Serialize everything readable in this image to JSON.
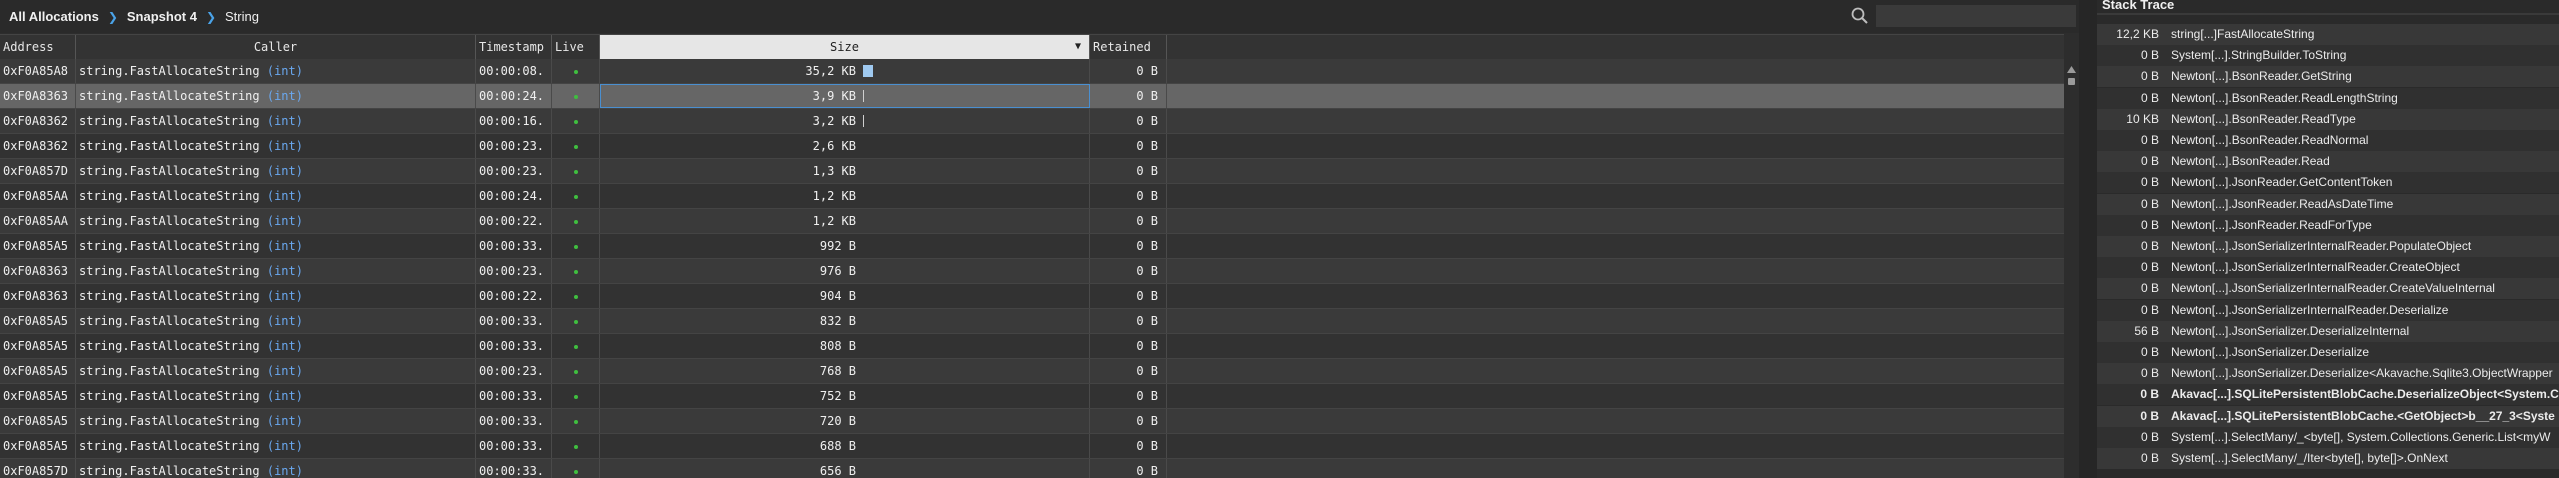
{
  "breadcrumb": {
    "items": [
      "All Allocations",
      "Snapshot 4",
      "String"
    ]
  },
  "search": {
    "value": "",
    "placeholder": ""
  },
  "grid": {
    "columns": {
      "address": "Address",
      "caller": "Caller",
      "timestamp": "Timestamp",
      "live": "Live",
      "size": "Size",
      "retained": "Retained"
    },
    "sort_indicator": "▼",
    "rows": [
      {
        "address": "0xF0A85A8",
        "caller_fn": "string.FastAllocateString",
        "caller_arg": "(int)",
        "timestamp": "00:00:08.",
        "size": "35,2 KB",
        "retained": "0 B",
        "bar": 0.95
      },
      {
        "address": "0xF0A8363",
        "caller_fn": "string.FastAllocateString",
        "caller_arg": "(int)",
        "timestamp": "00:00:24.",
        "size": "3,9 KB",
        "retained": "0 B",
        "bar": 0.1
      },
      {
        "address": "0xF0A8362",
        "caller_fn": "string.FastAllocateString",
        "caller_arg": "(int)",
        "timestamp": "00:00:16.",
        "size": "3,2 KB",
        "retained": "0 B",
        "bar": 0.08
      },
      {
        "address": "0xF0A8362",
        "caller_fn": "string.FastAllocateString",
        "caller_arg": "(int)",
        "timestamp": "00:00:23.",
        "size": "2,6 KB",
        "retained": "0 B",
        "bar": 0
      },
      {
        "address": "0xF0A857D",
        "caller_fn": "string.FastAllocateString",
        "caller_arg": "(int)",
        "timestamp": "00:00:23.",
        "size": "1,3 KB",
        "retained": "0 B",
        "bar": 0
      },
      {
        "address": "0xF0A85AA",
        "caller_fn": "string.FastAllocateString",
        "caller_arg": "(int)",
        "timestamp": "00:00:24.",
        "size": "1,2 KB",
        "retained": "0 B",
        "bar": 0
      },
      {
        "address": "0xF0A85AA",
        "caller_fn": "string.FastAllocateString",
        "caller_arg": "(int)",
        "timestamp": "00:00:22.",
        "size": "1,2 KB",
        "retained": "0 B",
        "bar": 0
      },
      {
        "address": "0xF0A85A5",
        "caller_fn": "string.FastAllocateString",
        "caller_arg": "(int)",
        "timestamp": "00:00:33.",
        "size": "992 B",
        "retained": "0 B",
        "bar": 0
      },
      {
        "address": "0xF0A8363",
        "caller_fn": "string.FastAllocateString",
        "caller_arg": "(int)",
        "timestamp": "00:00:23.",
        "size": "976 B",
        "retained": "0 B",
        "bar": 0
      },
      {
        "address": "0xF0A8363",
        "caller_fn": "string.FastAllocateString",
        "caller_arg": "(int)",
        "timestamp": "00:00:22.",
        "size": "904 B",
        "retained": "0 B",
        "bar": 0
      },
      {
        "address": "0xF0A85A5",
        "caller_fn": "string.FastAllocateString",
        "caller_arg": "(int)",
        "timestamp": "00:00:33.",
        "size": "832 B",
        "retained": "0 B",
        "bar": 0
      },
      {
        "address": "0xF0A85A5",
        "caller_fn": "string.FastAllocateString",
        "caller_arg": "(int)",
        "timestamp": "00:00:33.",
        "size": "808 B",
        "retained": "0 B",
        "bar": 0
      },
      {
        "address": "0xF0A85A5",
        "caller_fn": "string.FastAllocateString",
        "caller_arg": "(int)",
        "timestamp": "00:00:23.",
        "size": "768 B",
        "retained": "0 B",
        "bar": 0
      },
      {
        "address": "0xF0A85A5",
        "caller_fn": "string.FastAllocateString",
        "caller_arg": "(int)",
        "timestamp": "00:00:33.",
        "size": "752 B",
        "retained": "0 B",
        "bar": 0
      },
      {
        "address": "0xF0A85A5",
        "caller_fn": "string.FastAllocateString",
        "caller_arg": "(int)",
        "timestamp": "00:00:33.",
        "size": "720 B",
        "retained": "0 B",
        "bar": 0
      },
      {
        "address": "0xF0A85A5",
        "caller_fn": "string.FastAllocateString",
        "caller_arg": "(int)",
        "timestamp": "00:00:33.",
        "size": "688 B",
        "retained": "0 B",
        "bar": 0
      },
      {
        "address": "0xF0A857D",
        "caller_fn": "string.FastAllocateString",
        "caller_arg": "(int)",
        "timestamp": "00:00:33.",
        "size": "656 B",
        "retained": "0 B",
        "bar": 0
      }
    ]
  },
  "stack_trace": {
    "title": "Stack Trace",
    "frames": [
      {
        "size": "12,2 KB",
        "name": "string[...]FastAllocateString",
        "bold": false
      },
      {
        "size": "0 B",
        "name": "System[...].StringBuilder.ToString",
        "bold": false
      },
      {
        "size": "0 B",
        "name": "Newton[...].BsonReader.GetString",
        "bold": false
      },
      {
        "size": "0 B",
        "name": "Newton[...].BsonReader.ReadLengthString",
        "bold": false
      },
      {
        "size": "10 KB",
        "name": "Newton[...].BsonReader.ReadType",
        "bold": false
      },
      {
        "size": "0 B",
        "name": "Newton[...].BsonReader.ReadNormal",
        "bold": false
      },
      {
        "size": "0 B",
        "name": "Newton[...].BsonReader.Read",
        "bold": false
      },
      {
        "size": "0 B",
        "name": "Newton[...].JsonReader.GetContentToken",
        "bold": false
      },
      {
        "size": "0 B",
        "name": "Newton[...].JsonReader.ReadAsDateTime",
        "bold": false
      },
      {
        "size": "0 B",
        "name": "Newton[...].JsonReader.ReadForType",
        "bold": false
      },
      {
        "size": "0 B",
        "name": "Newton[...].JsonSerializerInternalReader.PopulateObject",
        "bold": false
      },
      {
        "size": "0 B",
        "name": "Newton[...].JsonSerializerInternalReader.CreateObject",
        "bold": false
      },
      {
        "size": "0 B",
        "name": "Newton[...].JsonSerializerInternalReader.CreateValueInternal",
        "bold": false
      },
      {
        "size": "0 B",
        "name": "Newton[...].JsonSerializerInternalReader.Deserialize",
        "bold": false
      },
      {
        "size": "56 B",
        "name": "Newton[...].JsonSerializer.DeserializeInternal",
        "bold": false
      },
      {
        "size": "0 B",
        "name": "Newton[...].JsonSerializer.Deserialize",
        "bold": false
      },
      {
        "size": "0 B",
        "name": "Newton[...].JsonSerializer.Deserialize<Akavache.Sqlite3.ObjectWrapper",
        "bold": false
      },
      {
        "size": "0 B",
        "name": "Akavac[...].SQLitePersistentBlobCache.DeserializeObject<System.C",
        "bold": true
      },
      {
        "size": "0 B",
        "name": "Akavac[...].SQLitePersistentBlobCache.<GetObject>b__27_3<Syste",
        "bold": true
      },
      {
        "size": "0 B",
        "name": "System[...].SelectMany/_<byte[], System.Collections.Generic.List<myW",
        "bold": false
      },
      {
        "size": "0 B",
        "name": "System[...].SelectMany/_/Iter<byte[], byte[]>.OnNext",
        "bold": false
      }
    ]
  },
  "colors": {
    "accent": "#4aa3e8",
    "arg_type": "#6aa8f0",
    "live_dot": "#3fbf3f",
    "size_bar": "#9fc9f0"
  }
}
